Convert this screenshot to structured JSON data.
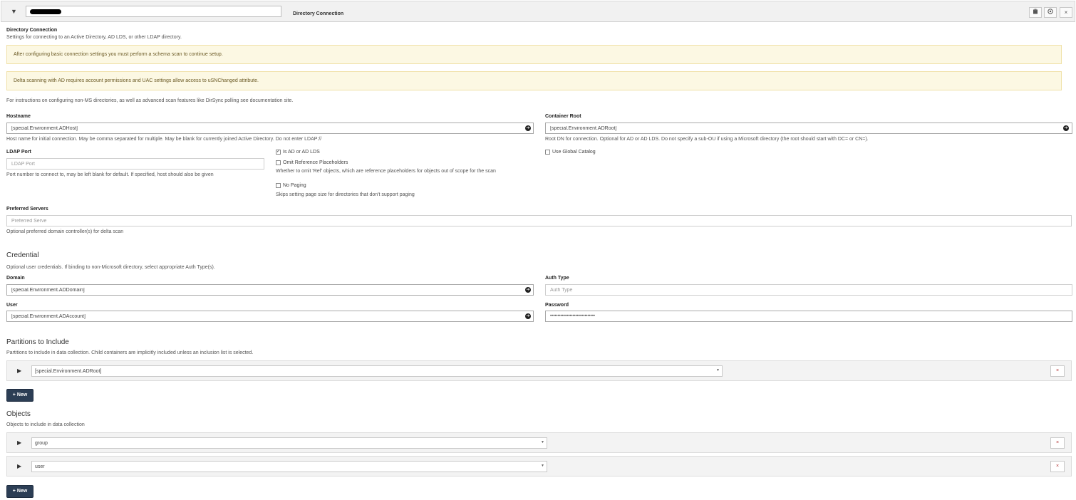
{
  "header": {
    "title_input_value": "",
    "title": "Directory Connection",
    "buttons": [
      "clipboard-icon",
      "target-icon",
      "close-icon"
    ]
  },
  "intro": {
    "heading": "Directory Connection",
    "subtitle": "Settings for connecting to an Active Directory, AD LDS, or other LDAP directory."
  },
  "alerts": [
    "After configuring basic connection settings you must perform a schema scan to continue setup.",
    "Delta scanning with AD requires account permissions and UAC settings allow access to uSNChanged attribute."
  ],
  "instructions": "For instructions on configuring non-MS directories, as well as advanced scan features like DirSync polling see documentation site.",
  "hostname": {
    "label": "Hostname",
    "value": "[special.Environment.ADHost]",
    "help": "Host name for initial connection. May be comma separated for multiple. May be blank for currently joined Active Directory. Do not enter LDAP://"
  },
  "container_root": {
    "label": "Container Root",
    "value": "[special.Environment.ADRoot]",
    "help": "Root DN for connection. Optional for AD or AD LDS. Do not specify a sub-OU if using a Microsoft directory (the root should start with DC= or CN=).",
    "global_catalog_label": "Use Global Catalog"
  },
  "ldap_port": {
    "label": "LDAP Port",
    "placeholder": "LDAP Port",
    "help": "Port number to connect to, may be left blank for default. If specified, host should also be given"
  },
  "options": {
    "is_ad_label": "Is AD or AD LDS",
    "omit_ref_label": "Omit Reference Placeholders",
    "omit_ref_help": "Whether to omit 'Ref' objects, which are reference placeholders for objects out of scope for the scan",
    "no_paging_label": "No Paging",
    "no_paging_help": "Skips setting page size for directories that don't support paging"
  },
  "preferred_servers": {
    "label": "Preferred Servers",
    "placeholder": "Preferred Serve",
    "help": "Optional preferred domain controller(s) for delta scan"
  },
  "credential": {
    "title": "Credential",
    "help": "Optional user credentials. If binding to non-Microsoft directory, select appropriate Auth Type(s).",
    "domain_label": "Domain",
    "domain_value": "[special.Environment.ADDomain]",
    "auth_type_label": "Auth Type",
    "auth_type_placeholder": "Auth Type",
    "user_label": "User",
    "user_value": "[special.Environment.ADAccount]",
    "password_label": "Password",
    "password_value": "••••••••••••••••••••••••••••••"
  },
  "partitions": {
    "title": "Partitions to Include",
    "help": "Partitions to include in data collection. Child containers are implicitly included unless an inclusion list is selected.",
    "items": [
      "[special.Environment.ADRoot]"
    ],
    "new_label": "+ New"
  },
  "objects": {
    "title": "Objects",
    "help": "Objects to include in data collection",
    "items": [
      "group",
      "user"
    ],
    "new_label": "+ New"
  }
}
